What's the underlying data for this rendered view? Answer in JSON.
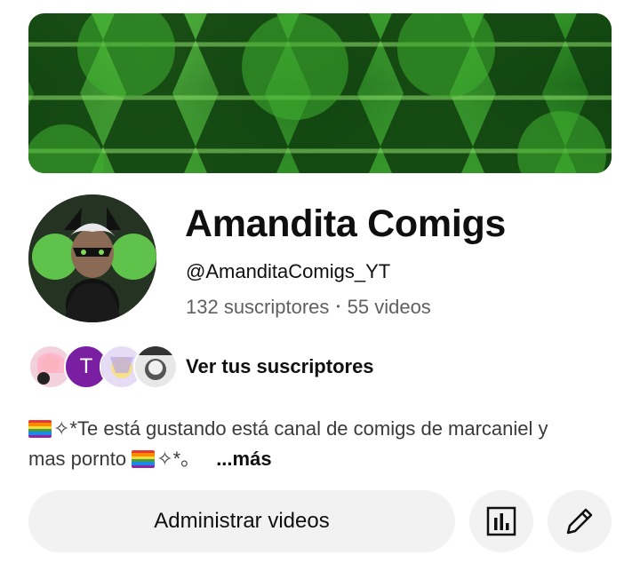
{
  "channel": {
    "name": "Amandita Comigs",
    "handle": "@AmanditaComigs_YT",
    "subscribers": "132 suscriptores",
    "separator": "•",
    "videos": "55 videos"
  },
  "subscribers_row": {
    "label": "Ver tus suscriptores",
    "letter_avatar": "T"
  },
  "description": {
    "line1": "✧*Te está gustando está canal de comigs de marcaniel y",
    "line2_start": "mas pornto",
    "line2_end": "✧*。",
    "more": "...más"
  },
  "buttons": {
    "manage_videos": "Administrar videos"
  },
  "icons": [
    "bar-chart-icon",
    "pencil-icon",
    "rainbow-flag-icon"
  ],
  "colors": {
    "banner_green": "#2c8a23",
    "button_bg": "#f2f2f2",
    "letter_avatar_bg": "#7b1fa2",
    "secondary_text": "#606060"
  }
}
